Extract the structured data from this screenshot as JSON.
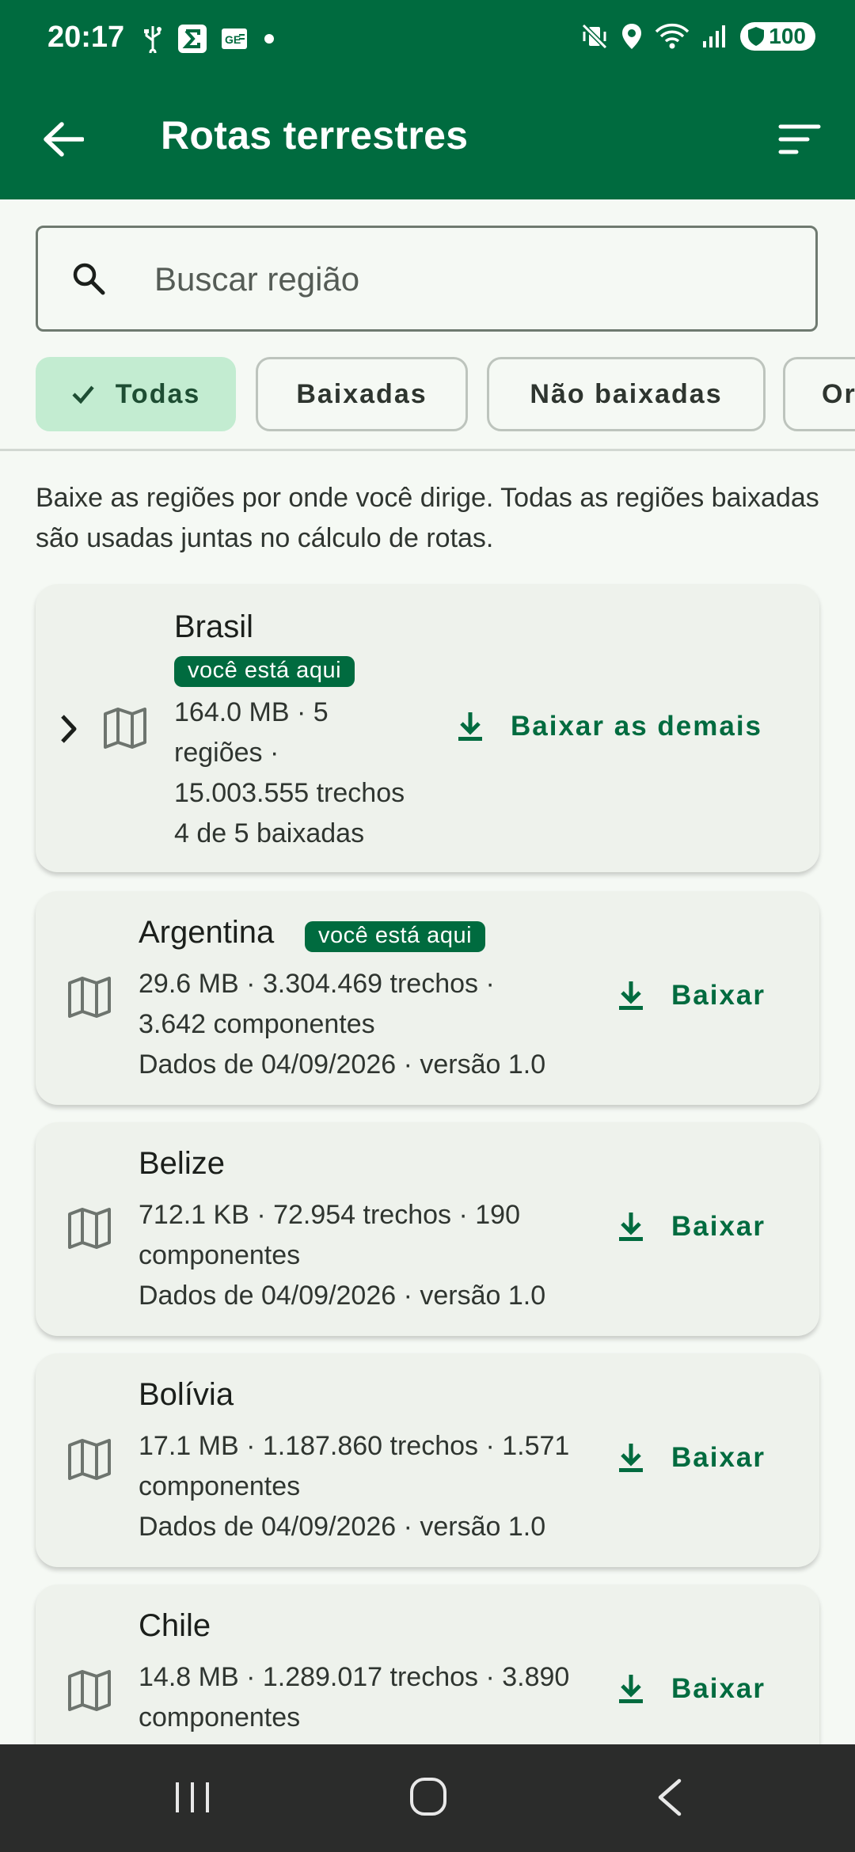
{
  "status": {
    "time": "20:17",
    "battery": "100",
    "left_icons": [
      "usb-icon",
      "sigma-app-icon",
      "ge-app-icon",
      "dot-icon"
    ],
    "right_icons": [
      "vibrate-mute-icon",
      "location-icon",
      "wifi-icon",
      "signal-icon",
      "battery-shield-icon"
    ]
  },
  "appbar": {
    "title": "Rotas terrestres",
    "back_icon": "arrow-left-icon",
    "sort_icon": "sort-lines-icon"
  },
  "search": {
    "placeholder": "Buscar região",
    "value": ""
  },
  "chips": [
    {
      "label": "Todas",
      "selected": true
    },
    {
      "label": "Baixadas",
      "selected": false
    },
    {
      "label": "Não baixadas",
      "selected": false
    },
    {
      "label": "Or",
      "selected": false
    }
  ],
  "intro": "Baixe as regiões por onde você dirige. Todas as regiões baixadas são usadas juntas no cálculo de rotas.",
  "regions": [
    {
      "name": "Brasil",
      "badge": "você está aqui",
      "line1": "164.0 MB · 5",
      "line2": "regiões ·",
      "line3": "15.003.555 trechos",
      "line4": "4 de 5 baixadas",
      "action": "Baixar as demais"
    },
    {
      "name": "Argentina",
      "badge": "você está aqui",
      "line1": "29.6 MB · 3.304.469 trechos ·",
      "line2": "3.642 componentes",
      "line3": "Dados de 04/09/2026 · versão 1.0",
      "action": "Baixar"
    },
    {
      "name": "Belize",
      "line1": "712.1 KB · 72.954 trechos · 190",
      "line2": "componentes",
      "line3": "Dados de 04/09/2026 · versão 1.0",
      "action": "Baixar"
    },
    {
      "name": "Bolívia",
      "line1": "17.1 MB · 1.187.860 trechos · 1.571",
      "line2": "componentes",
      "line3": "Dados de 04/09/2026 · versão 1.0",
      "action": "Baixar"
    },
    {
      "name": "Chile",
      "line1": "14.8 MB · 1.289.017 trechos · 3.890",
      "line2": "componentes",
      "action": "Baixar"
    }
  ],
  "colors": {
    "primary": "#006b3f",
    "chip_selected": "#c3ecd1",
    "card": "#eef2ec",
    "background": "#f5f9f4",
    "navbar": "#2b2c2b"
  }
}
